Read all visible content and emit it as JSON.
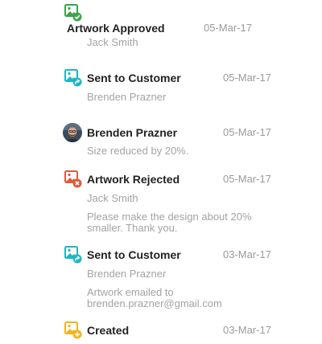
{
  "activity": [
    {
      "icon": "image-check-icon",
      "title": "Artwork Approved",
      "date": "05-Mar-17",
      "user": "Jack Smith"
    },
    {
      "icon": "image-share-icon",
      "title": "Sent to Customer",
      "date": "05-Mar-17",
      "user": "Brenden Prazner"
    },
    {
      "icon": "avatar",
      "title": "Brenden Prazner",
      "date": "05-Mar-17",
      "comment": "Size reduced by 20%."
    },
    {
      "icon": "image-reject-icon",
      "title": "Artwork Rejected",
      "date": "05-Mar-17",
      "user": "Jack Smith",
      "comment_line1": "Please make the design about 20%",
      "comment_line2": "smaller. Thank you."
    },
    {
      "icon": "image-share-icon",
      "title": "Sent to Customer",
      "date": "03-Mar-17",
      "user": "Brenden Prazner",
      "comment_line1": "Artwork emailed to",
      "comment_line2": "brenden.prazner@gmail.com"
    },
    {
      "icon": "image-add-icon",
      "title": "Created",
      "date": "03-Mar-17"
    }
  ],
  "colors": {
    "approved": "#3aa64a",
    "sent": "#1bb8c4",
    "rejected": "#e2593b",
    "created": "#f2b51d"
  }
}
